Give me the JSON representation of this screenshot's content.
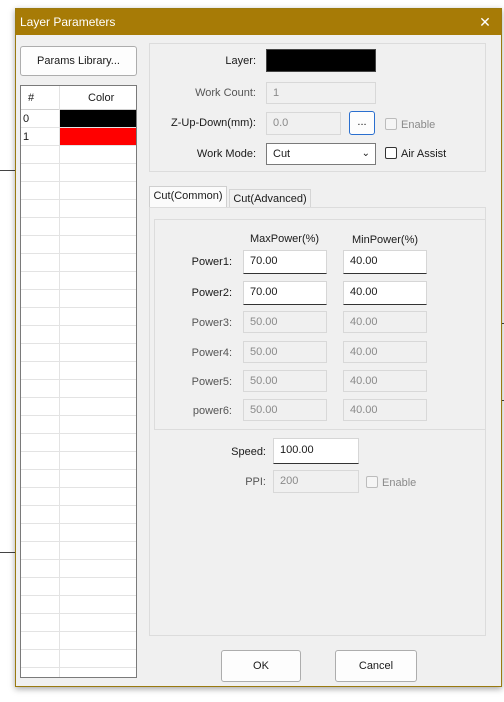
{
  "dialog": {
    "title": "Layer Parameters",
    "close_glyph": "✕"
  },
  "left": {
    "params_library_label": "Params Library...",
    "table_headers": [
      "#",
      "Color"
    ],
    "rows": [
      {
        "index": "0",
        "color": "#000000"
      },
      {
        "index": "1",
        "color": "#ff0000"
      }
    ]
  },
  "top": {
    "layer_label": "Layer:",
    "layer_color": "#000000",
    "work_count_label": "Work Count:",
    "work_count_value": "1",
    "zupdown_label": "Z-Up-Down(mm):",
    "zupdown_value": "0.0",
    "dots_label": "...",
    "enable_label": "Enable",
    "work_mode_label": "Work Mode:",
    "work_mode_value": "Cut",
    "air_assist_label": "Air Assist"
  },
  "tabs": [
    "Cut(Common)",
    "Cut(Advanced)"
  ],
  "power": {
    "max_header": "MaxPower(%)",
    "min_header": "MinPower(%)",
    "rows": [
      {
        "label": "Power1:",
        "max": "70.00",
        "min": "40.00",
        "enabled": true
      },
      {
        "label": "Power2:",
        "max": "70.00",
        "min": "40.00",
        "enabled": true
      },
      {
        "label": "Power3:",
        "max": "50.00",
        "min": "40.00",
        "enabled": false
      },
      {
        "label": "Power4:",
        "max": "50.00",
        "min": "40.00",
        "enabled": false
      },
      {
        "label": "Power5:",
        "max": "50.00",
        "min": "40.00",
        "enabled": false
      },
      {
        "label": "power6:",
        "max": "50.00",
        "min": "40.00",
        "enabled": false
      }
    ]
  },
  "speed": {
    "label": "Speed:",
    "value": "100.00"
  },
  "ppi": {
    "label": "PPI:",
    "value": "200",
    "enable_label": "Enable"
  },
  "footer": {
    "ok_label": "OK",
    "cancel_label": "Cancel"
  }
}
